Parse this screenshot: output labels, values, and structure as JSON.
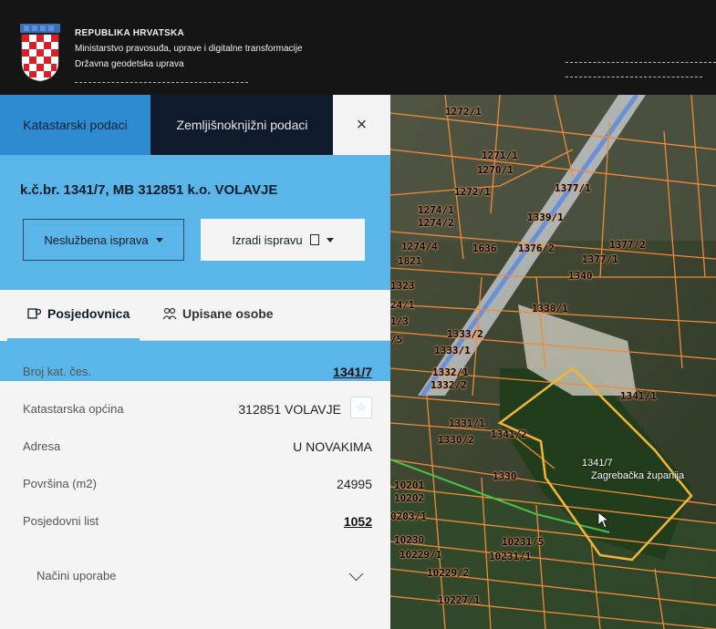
{
  "header": {
    "line1": "REPUBLIKA HRVATSKA",
    "line2": "Ministarstvo pravosuđa, uprave i digitalne transformacije",
    "line3": "Državna geodetska uprava"
  },
  "tabs": {
    "active": "Katastarski podaci",
    "second": "Zemljišnoknjižni podaci",
    "close": "×"
  },
  "parcel": {
    "title": "k.č.br. 1341/7, MB 312851 k.o. VOLAVJE",
    "btn_neslužbena": "Neslužbena isprava",
    "btn_izradi": "Izradi ispravu"
  },
  "subtabs": {
    "posjednica": "Posjedovnica",
    "osobe": "Upisane osobe"
  },
  "rows": [
    {
      "label": "Broj kat. čes.",
      "value": "1341/7"
    },
    {
      "label": "Katastarska općina",
      "value": "312851 VOLAVJE"
    },
    {
      "label": "Adresa",
      "value": "U NOVAKIMA"
    },
    {
      "label": "Površina (m2)",
      "value": "24995"
    },
    {
      "label": "Posjedovni list",
      "value": "1052"
    }
  ],
  "uporabe": "Načini uporabe",
  "map": {
    "labels": [
      "1377/1",
      "1272/1",
      "1270/1",
      "1271/1",
      "1274/1",
      "1274/2",
      "1274/4",
      "1821",
      "1333/2",
      "1333/1",
      "1332/1",
      "1332/2",
      "1331/1",
      "1330/2",
      "1341/2",
      "1341/1",
      "1340",
      "1339/1",
      "1376/2",
      "1377/2",
      "1636",
      "1338/1",
      "1323",
      "24/1",
      "1/3",
      "/5",
      "1330",
      "10201",
      "10202",
      "0203/1",
      "10230",
      "10229/1",
      "10231/1",
      "10231/5",
      "10229/2",
      "10227/1",
      "1341/7",
      "Zagrebačka županija"
    ],
    "star": "☆"
  }
}
